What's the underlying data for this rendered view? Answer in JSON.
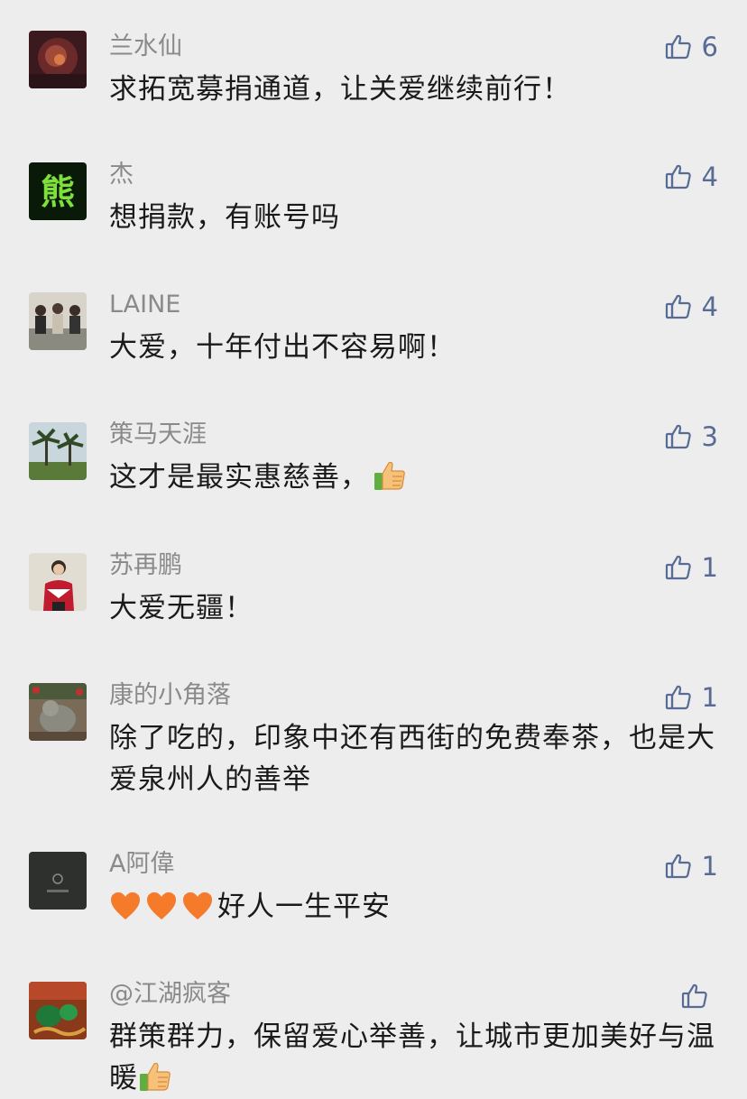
{
  "colors": {
    "background": "#ededed",
    "name": "#8a8a8a",
    "text": "#1a1a1a",
    "like": "#576b95"
  },
  "comments": [
    {
      "name": "兰水仙",
      "text": "求拓宽募捐通道，让关爱继续前行！",
      "likes": "6"
    },
    {
      "name": "杰",
      "text": "想捐款，有账号吗",
      "likes": "4",
      "avatar_text": "熊"
    },
    {
      "name": "LAINE",
      "text": "大爱，十年付出不容易啊！",
      "likes": "4"
    },
    {
      "name": "策马天涯",
      "text": "这才是最实惠慈善，",
      "likes": "3",
      "emoji": "thumbs-up-emoji"
    },
    {
      "name": "苏再鹏",
      "text": "大爱无疆！",
      "likes": "1"
    },
    {
      "name": "康的小角落",
      "text": "除了吃的，印象中还有西街的免费奉茶，也是大爱泉州人的善举",
      "likes": "1"
    },
    {
      "name": "A阿偉",
      "text": "好人一生平安",
      "likes": "1",
      "emoji": "orange-heart-emoji"
    },
    {
      "name": "@江湖疯客",
      "text": "群策群力，保留爱心举善，让城市更加美好与温暖",
      "likes": "",
      "emoji": "thumbs-up-emoji"
    }
  ]
}
